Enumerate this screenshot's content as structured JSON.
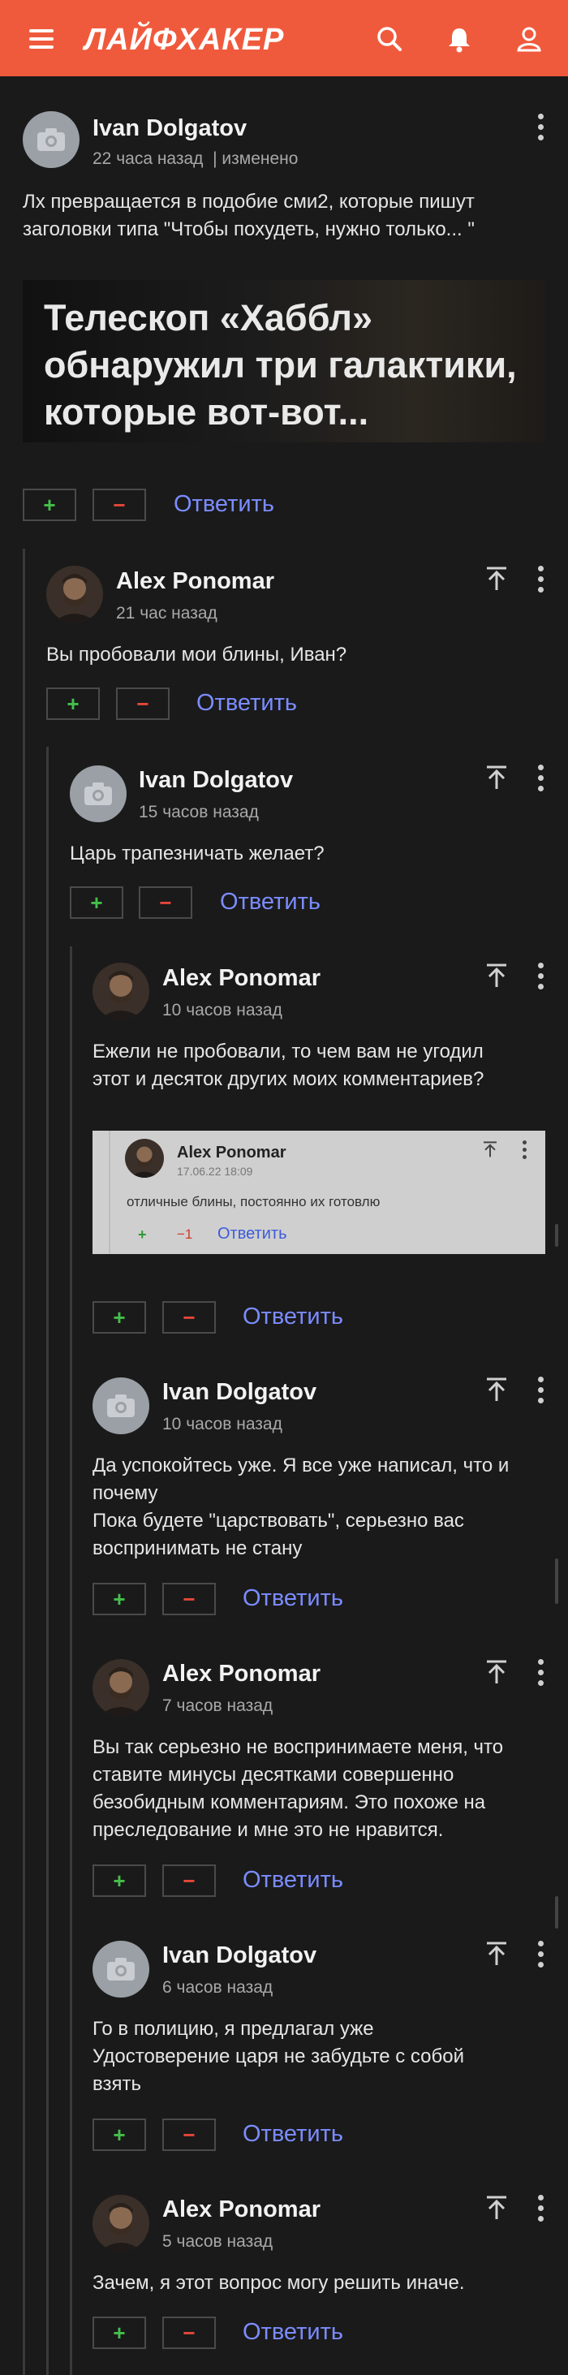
{
  "header": {
    "logo": "ЛАЙФХАКЕР",
    "icons": [
      "menu-icon",
      "search-icon",
      "bell-icon",
      "user-icon"
    ],
    "color": "#f05a3c"
  },
  "root": {
    "author": "Ivan Dolgatov",
    "time": "22 часа назад",
    "edited": "| изменено",
    "text": [
      "Лх превращается в подобие сми2, которые пишут",
      "заголовки типа \"Чтобы похудеть, нужно только... \""
    ],
    "banner": "Телескоп «Хаббл» обнаружил три галактики, которые вот-вот...",
    "reply": "Ответить",
    "plus": "+",
    "minus": "−"
  },
  "comments": [
    {
      "author": "Alex Ponomar",
      "time": "21 час назад",
      "text": [
        "Вы пробовали мои блины, Иван?"
      ],
      "avatar": "photo"
    },
    {
      "author": "Ivan Dolgatov",
      "time": "15 часов назад",
      "text": [
        "Царь трапезничать желает?"
      ],
      "avatar": "placeholder"
    },
    {
      "author": "Alex Ponomar",
      "time": "10 часов назад",
      "text": [
        "Ежели не пробовали, то чем вам не угодил",
        "этот и десяток других моих комментариев?"
      ],
      "avatar": "photo"
    },
    {
      "author": "Ivan Dolgatov",
      "time": "10 часов назад",
      "text": [
        "Да успокойтесь уже. Я все уже написал, что и",
        "почему",
        "Пока будете \"царствовать\", серьезно вас",
        "воспринимать не стану"
      ],
      "avatar": "placeholder"
    },
    {
      "author": "Alex Ponomar",
      "time": "7 часов назад",
      "text": [
        "Вы так серьезно не воспринимаете меня, что",
        "ставите минусы десятками совершенно",
        "безобидным комментариям. Это похоже на",
        "преследование и мне это не нравится."
      ],
      "avatar": "photo"
    },
    {
      "author": "Ivan Dolgatov",
      "time": "6 часов назад",
      "text": [
        "Го в полицию, я предлагал уже",
        "Удостоверение царя не забудьте с собой",
        "взять"
      ],
      "avatar": "placeholder"
    },
    {
      "author": "Alex Ponomar",
      "time": "5 часов назад",
      "text": [
        "Зачем, я этот вопрос могу решить иначе."
      ],
      "avatar": "photo"
    }
  ],
  "embed": {
    "author": "Alex Ponomar",
    "date": "17.06.22 18:09",
    "text": "отличные блины, постоянно их готовлю",
    "plus": "+",
    "minus": "−1",
    "reply": "Ответить"
  }
}
